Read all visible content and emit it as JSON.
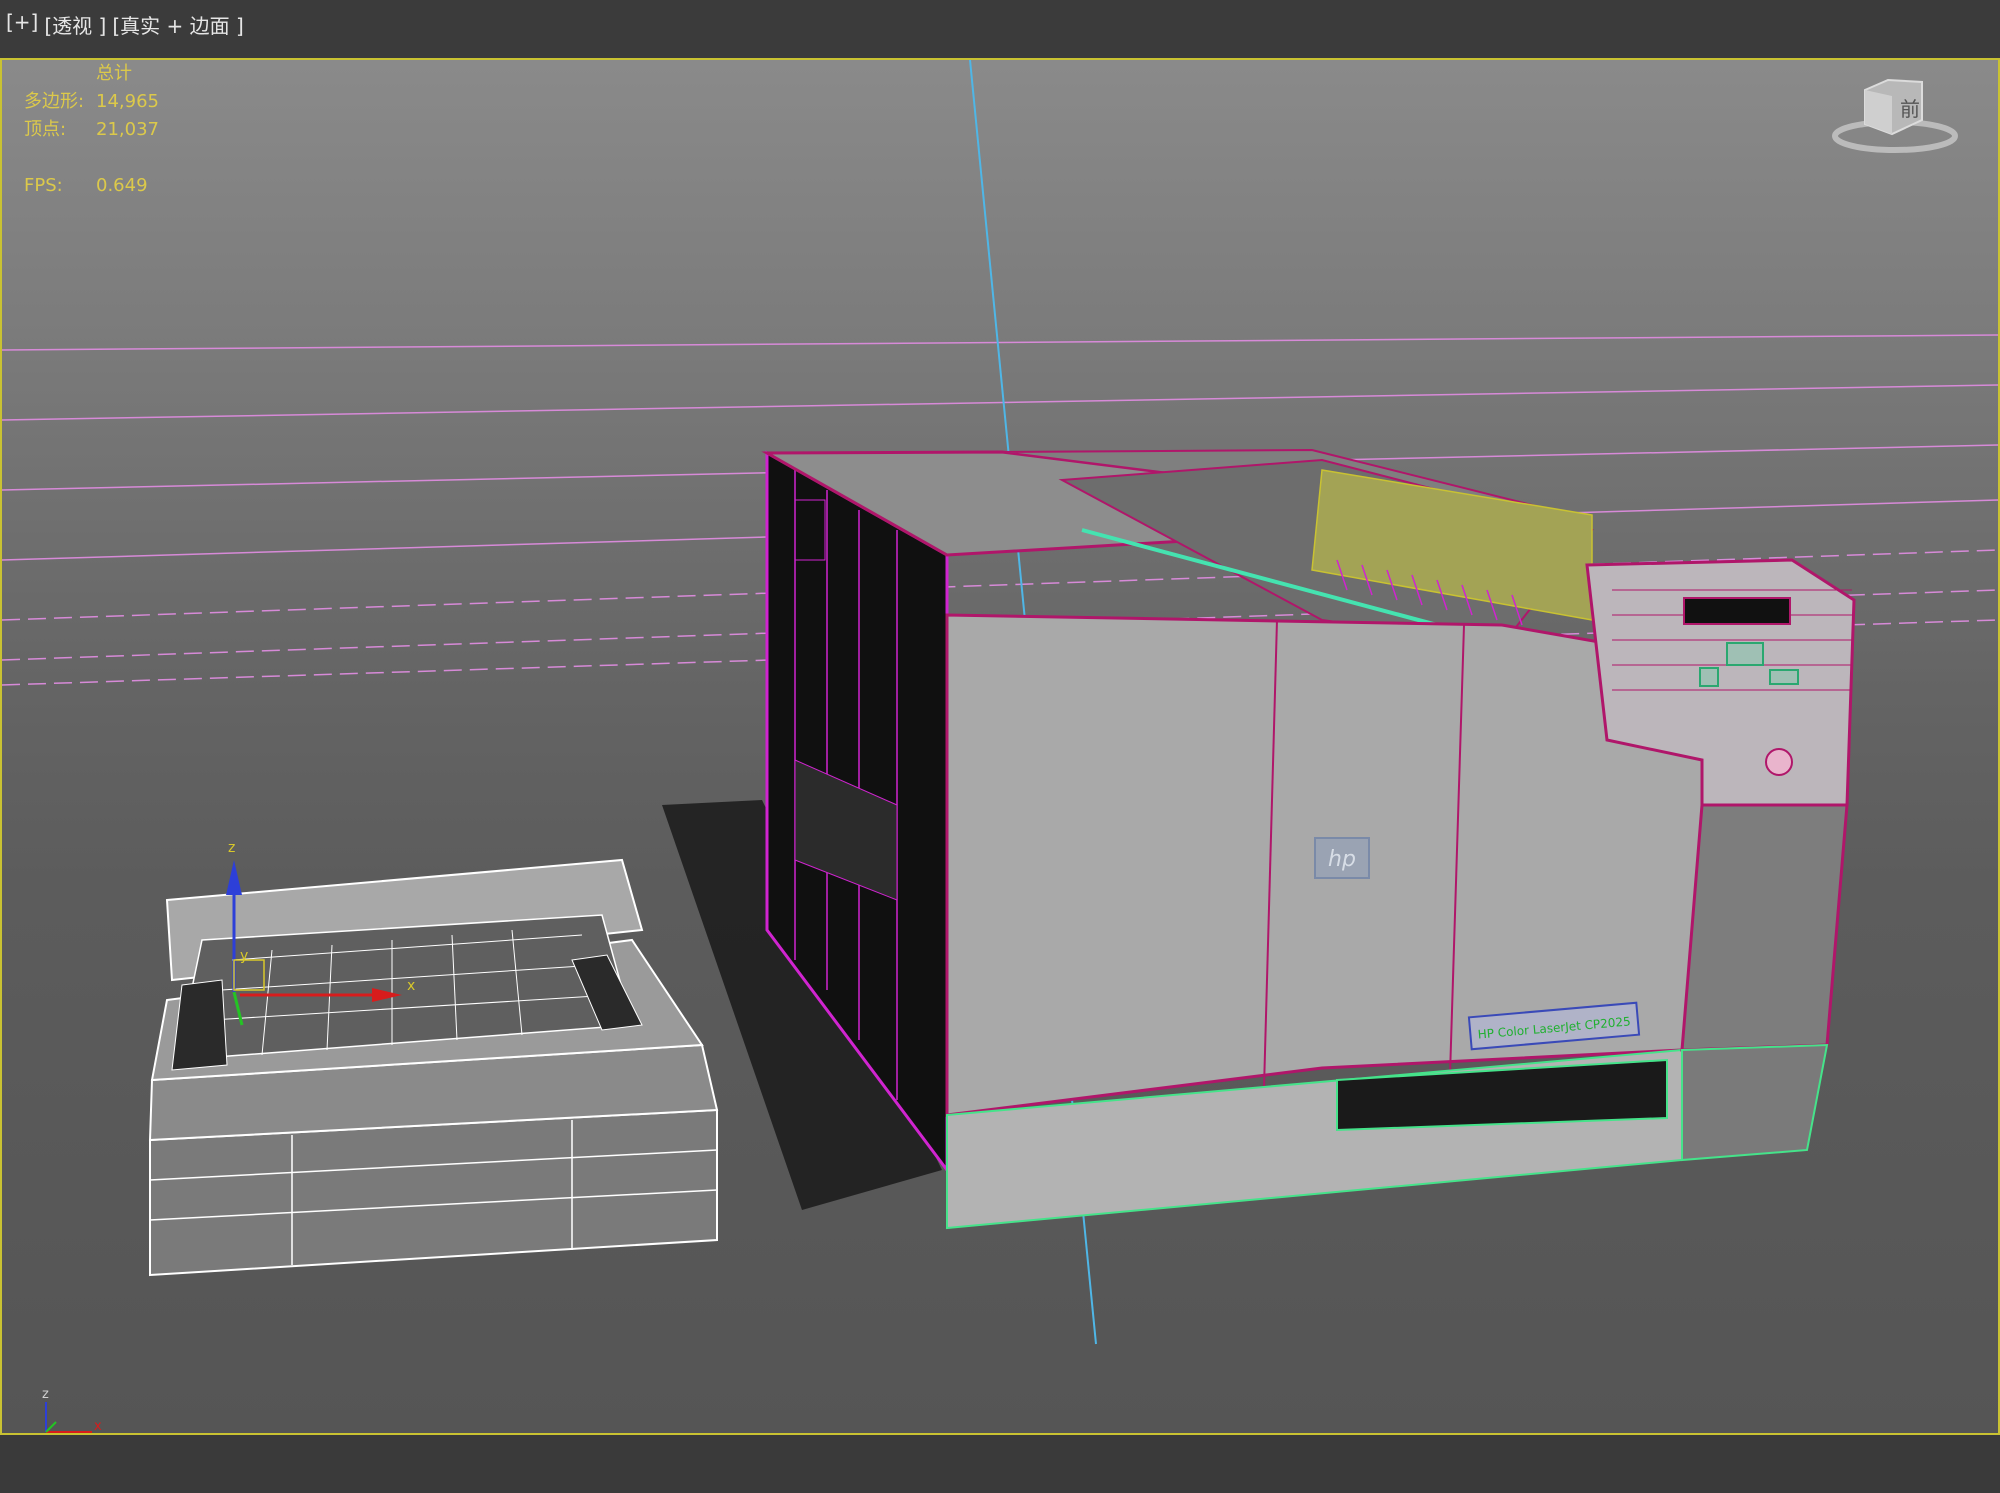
{
  "viewport_labels": [
    "[+]",
    "[透视 ]",
    "[真实 + 边面 ]"
  ],
  "stats": {
    "total_label": "总计",
    "polygons_label": "多边形:",
    "polygons_value": "14,965",
    "vertices_label": "顶点:",
    "vertices_value": "21,037",
    "fps_label": "FPS:",
    "fps_value": "0.649"
  },
  "viewcube": {
    "face_label": "前"
  },
  "printer": {
    "brand_logo": "hp",
    "model_label": "HP Color LaserJet CP2025"
  },
  "gizmo_axes": {
    "x": "x",
    "y": "y",
    "z": "z"
  },
  "axis_tripod": {
    "x": "x",
    "z": "z"
  },
  "colors": {
    "viewport_border": "#c9c232",
    "stats_text": "#dcc94a",
    "selection_wire": "#b0166a",
    "grid_lines": "#d78ad8",
    "cyan_axis": "#4fb6e6",
    "green_wire": "#45e38a"
  }
}
